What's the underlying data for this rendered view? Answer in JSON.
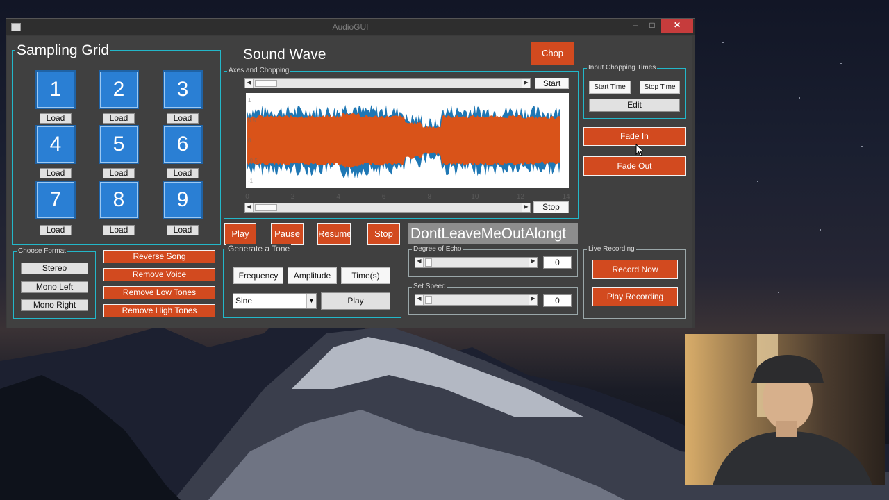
{
  "window": {
    "title": "AudioGUI",
    "minimize_glyph": "–",
    "maximize_glyph": "□",
    "close_glyph": "✕"
  },
  "sampling_grid": {
    "title": "Sampling Grid",
    "pads": [
      {
        "label": "1",
        "load_label": "Load"
      },
      {
        "label": "2",
        "load_label": "Load"
      },
      {
        "label": "3",
        "load_label": "Load"
      },
      {
        "label": "4",
        "load_label": "Load"
      },
      {
        "label": "5",
        "load_label": "Load"
      },
      {
        "label": "6",
        "load_label": "Load"
      },
      {
        "label": "7",
        "load_label": "Load"
      },
      {
        "label": "8",
        "load_label": "Load"
      },
      {
        "label": "9",
        "load_label": "Load"
      }
    ]
  },
  "sound_wave": {
    "heading": "Sound Wave",
    "chop_label": "Chop",
    "axes_panel_title": "Axes and Chopping",
    "start_label": "Start",
    "stop_label": "Stop",
    "x_ticks": [
      "0",
      "2",
      "4",
      "6",
      "8",
      "10",
      "12",
      "14"
    ],
    "y_ticks": [
      "1",
      "0.5",
      "0",
      "-0.5",
      "-1"
    ],
    "colors": {
      "channel_1": "#1f77b4",
      "channel_2": "#d95319"
    }
  },
  "chopping_times": {
    "title": "Input Chopping Times",
    "start_time_label": "Start Time",
    "stop_time_label": "Stop Time",
    "edit_label": "Edit"
  },
  "fades": {
    "fade_in_label": "Fade In",
    "fade_out_label": "Fade Out"
  },
  "playback": {
    "play_label": "Play",
    "pause_label": "Pause",
    "resume_label": "Resume",
    "stop_label": "Stop",
    "song_name": "DontLeaveMeOutAlongt"
  },
  "choose_format": {
    "title": "Choose Format",
    "options": [
      "Stereo",
      "Mono Left",
      "Mono Right"
    ]
  },
  "effects": [
    "Reverse Song",
    "Remove Voice",
    "Remove Low Tones",
    "Remove High Tones"
  ],
  "tone": {
    "title": "Generate a Tone",
    "frequency_label": "Frequency",
    "amplitude_label": "Amplitude",
    "time_label": "Time(s)",
    "wave_type": "Sine",
    "play_label": "Play"
  },
  "echo": {
    "title": "Degree of Echo",
    "value": "0",
    "level": 0.0
  },
  "speed": {
    "title": "Set Speed",
    "value": "0",
    "level": 0.0
  },
  "live_recording": {
    "title": "Live Recording",
    "record_label": "Record Now",
    "play_recording_label": "Play Recording"
  }
}
